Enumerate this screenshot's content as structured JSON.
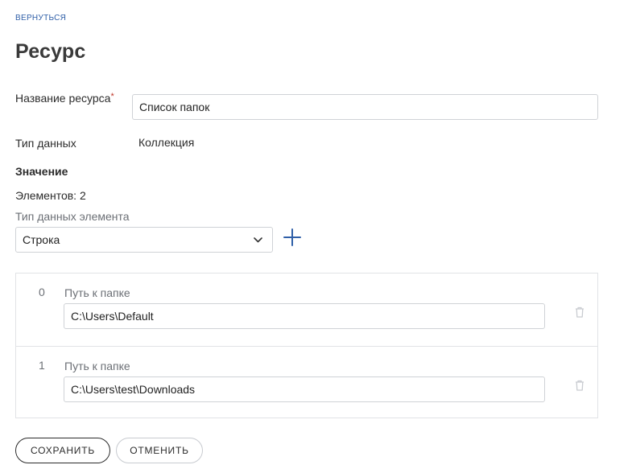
{
  "nav": {
    "back_label": "ВЕРНУТЬСЯ"
  },
  "page": {
    "title": "Ресурс"
  },
  "form": {
    "name_label": "Название ресурса",
    "required_mark": "*",
    "name_value": "Список папок",
    "type_label": "Тип данных",
    "type_value": "Коллекция",
    "value_section_title": "Значение",
    "elements_count_text": "Элементов: 2",
    "element_type_label": "Тип данных элемента",
    "element_type_selected": "Строка"
  },
  "items": [
    {
      "index": "0",
      "label": "Путь к папке",
      "value": "C:\\Users\\Default"
    },
    {
      "index": "1",
      "label": "Путь к папке",
      "value": "C:\\Users\\test\\Downloads"
    }
  ],
  "actions": {
    "save_label": "СОХРАНИТЬ",
    "cancel_label": "ОТМЕНИТЬ"
  },
  "colors": {
    "accent_blue": "#2f5fa8",
    "required_red": "#c0392b",
    "border": "#cfd2d6",
    "muted_text": "#6b6f75"
  },
  "icons": {
    "dropdown": "chevron-down-icon",
    "add": "plus-icon",
    "delete": "trash-icon"
  }
}
